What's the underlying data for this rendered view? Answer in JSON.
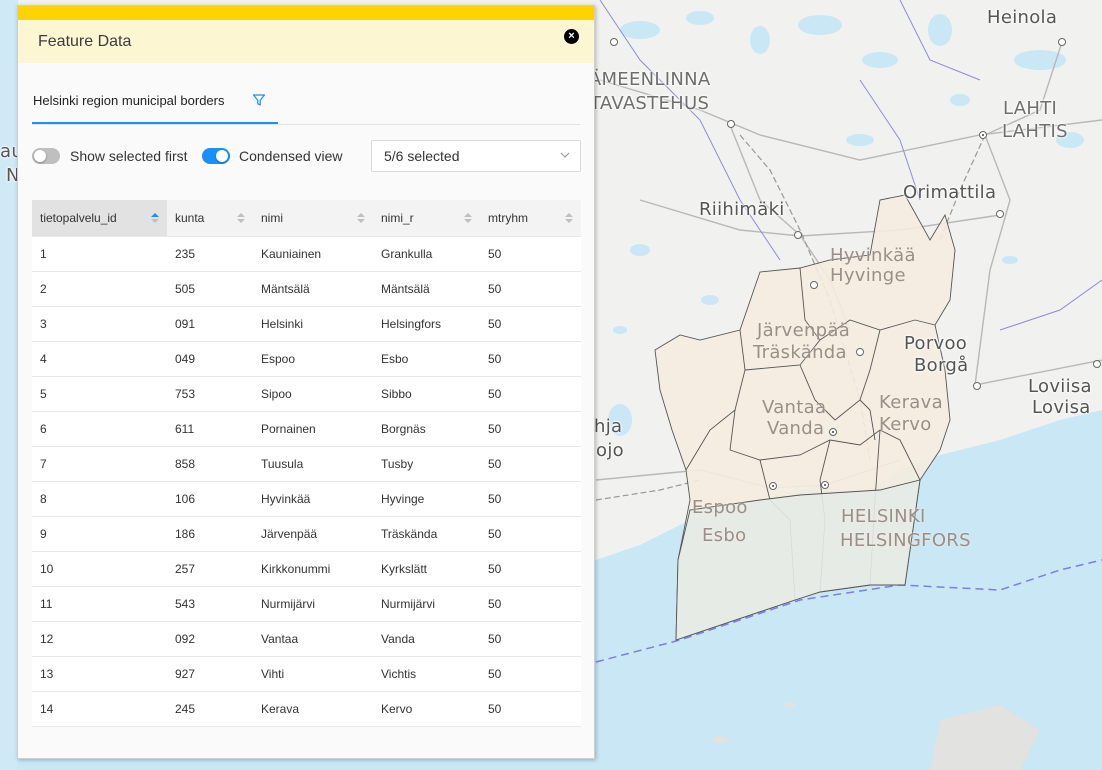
{
  "map": {
    "labels": [
      {
        "text": "Heinola",
        "kind": "base"
      },
      {
        "text": "HÄMEENLINNA",
        "kind": "big"
      },
      {
        "text": "TAVASTEHUS",
        "kind": "big"
      },
      {
        "text": "LAHTI",
        "kind": "big"
      },
      {
        "text": "LAHTIS",
        "kind": "big"
      },
      {
        "text": "Riihimäki",
        "kind": "base"
      },
      {
        "text": "Orimattila",
        "kind": "base"
      },
      {
        "text": "Hyvinkää",
        "kind": "overlay"
      },
      {
        "text": "Hyvinge",
        "kind": "overlay"
      },
      {
        "text": "Järvenpää",
        "kind": "overlay"
      },
      {
        "text": "Träskända",
        "kind": "overlay"
      },
      {
        "text": "Porvoo",
        "kind": "base"
      },
      {
        "text": "Borgå",
        "kind": "base"
      },
      {
        "text": "Loviisa",
        "kind": "base"
      },
      {
        "text": "Lovisa",
        "kind": "base"
      },
      {
        "text": "Vantaa",
        "kind": "overlay"
      },
      {
        "text": "Vanda",
        "kind": "overlay"
      },
      {
        "text": "Kerava",
        "kind": "overlay"
      },
      {
        "text": "Kervo",
        "kind": "overlay"
      },
      {
        "text": "hja",
        "kind": "base"
      },
      {
        "text": "ojo",
        "kind": "base"
      },
      {
        "text": "Espoo",
        "kind": "overlay"
      },
      {
        "text": "Esbo",
        "kind": "overlay"
      },
      {
        "text": "HELSINKI",
        "kind": "overlay"
      },
      {
        "text": "HELSINGFORS",
        "kind": "overlay"
      },
      {
        "text": "au",
        "kind": "base"
      },
      {
        "text": "N",
        "kind": "base"
      }
    ]
  },
  "flyout": {
    "title": "Feature Data",
    "close_label": "×",
    "tab": {
      "label": "Helsinki region municipal borders"
    },
    "controls": {
      "show_selected_first": {
        "label": "Show selected first",
        "on": false
      },
      "condensed_view": {
        "label": "Condensed view",
        "on": true
      },
      "columns_select": {
        "value": "5/6 selected"
      }
    },
    "table": {
      "columns": [
        "tietopalvelu_id",
        "kunta",
        "nimi",
        "nimi_r",
        "mtryhm"
      ],
      "sorted_column": "tietopalvelu_id",
      "sort_direction": "ascending",
      "rows": [
        [
          "1",
          "235",
          "Kauniainen",
          "Grankulla",
          "50"
        ],
        [
          "2",
          "505",
          "Mäntsälä",
          "Mäntsälä",
          "50"
        ],
        [
          "3",
          "091",
          "Helsinki",
          "Helsingfors",
          "50"
        ],
        [
          "4",
          "049",
          "Espoo",
          "Esbo",
          "50"
        ],
        [
          "5",
          "753",
          "Sipoo",
          "Sibbo",
          "50"
        ],
        [
          "6",
          "611",
          "Pornainen",
          "Borgnäs",
          "50"
        ],
        [
          "7",
          "858",
          "Tuusula",
          "Tusby",
          "50"
        ],
        [
          "8",
          "106",
          "Hyvinkää",
          "Hyvinge",
          "50"
        ],
        [
          "9",
          "186",
          "Järvenpää",
          "Träskända",
          "50"
        ],
        [
          "10",
          "257",
          "Kirkkonummi",
          "Kyrkslätt",
          "50"
        ],
        [
          "11",
          "543",
          "Nurmijärvi",
          "Nurmijärvi",
          "50"
        ],
        [
          "12",
          "092",
          "Vantaa",
          "Vanda",
          "50"
        ],
        [
          "13",
          "927",
          "Vihti",
          "Vichtis",
          "50"
        ],
        [
          "14",
          "245",
          "Kerava",
          "Kervo",
          "50"
        ]
      ]
    }
  },
  "colors": {
    "accent": "#1890ff",
    "header_bar": "#fdd400",
    "header_bg": "#fdf6d3",
    "map_sea": "#c9e7f5",
    "map_land": "#f2f2f0",
    "region_fill": "#f5ece0"
  }
}
